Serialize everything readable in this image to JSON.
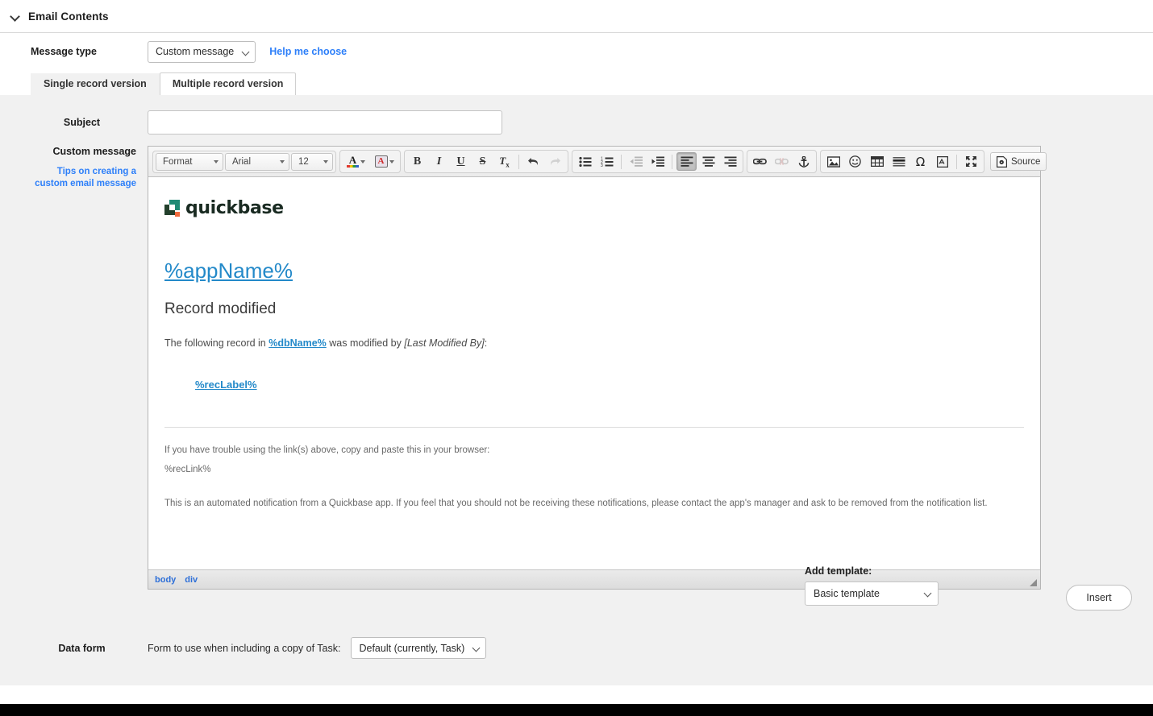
{
  "section": {
    "title": "Email Contents",
    "collapse_icon": "chevron-down-icon"
  },
  "message_type": {
    "label": "Message type",
    "selected": "Custom message",
    "help_link": "Help me choose"
  },
  "tabs": [
    {
      "label": "Single record version",
      "active": true
    },
    {
      "label": "Multiple record version",
      "active": false
    }
  ],
  "subject": {
    "label": "Subject",
    "value": "",
    "placeholder": ""
  },
  "custom_message": {
    "label": "Custom message",
    "tips_link": "Tips on creating a custom email message"
  },
  "editor": {
    "toolbar": {
      "format_combo": "Format",
      "font_combo": "Arial",
      "size_combo": "12",
      "text_color": "A",
      "bg_color": "A",
      "bold": "B",
      "italic": "I",
      "underline": "U",
      "strike": "S",
      "remove_format": "Tx",
      "undo": "↶",
      "redo": "↷",
      "bulleted_list": "bulleted-list-icon",
      "numbered_list": "numbered-list-icon",
      "outdent": "outdent-icon",
      "indent": "indent-icon",
      "align_left": "align-left-icon",
      "align_center": "align-center-icon",
      "align_right": "align-right-icon",
      "link": "link-icon",
      "unlink": "unlink-icon",
      "anchor": "anchor-icon",
      "image": "image-icon",
      "smiley": "☺",
      "table": "table-icon",
      "horizontal_rule": "horizontal-rule-icon",
      "special_char": "Ω",
      "page_break": "page-break-icon",
      "maximize": "maximize-icon",
      "source_label": "Source"
    },
    "status_path": [
      "body",
      "div"
    ],
    "content": {
      "logo_text": "quickbase",
      "app_name_link": "%appName%",
      "heading": "Record modified",
      "intro_prefix": "The following record in ",
      "db_name_link": "%dbName%",
      "intro_middle": " was modified by ",
      "modified_by": "[Last Modified By]",
      "intro_suffix": ":",
      "rec_label_link": "%recLabel%",
      "trouble_text": "If you have trouble using the link(s) above, copy and paste this in your browser:",
      "rec_link": "%recLink%",
      "footer_text": "This is an automated notification from a Quickbase app. If you feel that you should not be receiving these notifications, please contact the app's manager and ask to be removed from the notification list."
    }
  },
  "add_template": {
    "label": "Add template:",
    "selected": "Basic template",
    "insert_button": "Insert"
  },
  "data_form": {
    "label": "Data form",
    "description": "Form to use when including a copy of Task:",
    "selected": "Default (currently, Task)"
  },
  "colors": {
    "link_blue": "#2d7ff9",
    "email_link_blue": "#2389c9",
    "panel_gray": "#f1f1f1",
    "logo_teal": "#1f8a75",
    "logo_dark": "#23402c",
    "logo_orange": "#ef6a3c"
  }
}
